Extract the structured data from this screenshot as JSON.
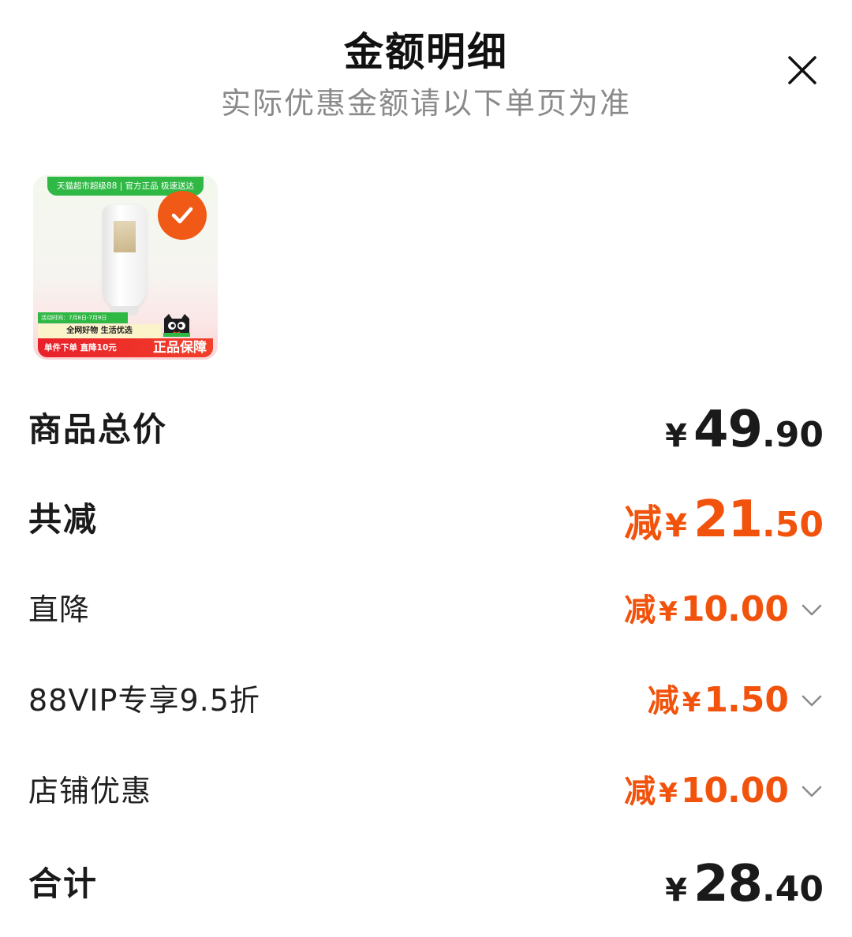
{
  "header": {
    "title": "金额明细",
    "subtitle": "实际优惠金额请以下单页为准",
    "close_icon": "close-icon"
  },
  "product": {
    "thumbnail": {
      "top_banner": "天猫超市超级88 | 官方正品 极速送达",
      "event_date": "活动时间：7月8日-7月9日",
      "slogan": "全网好物 生活优选",
      "promo": "单件下单 直降10元",
      "guarantee": "正品保障",
      "selected_icon": "check-circle-icon",
      "mascot_icon": "tmall-cat-icon"
    }
  },
  "summary": {
    "goods_total": {
      "label": "商品总价",
      "yen": "¥",
      "int": "49",
      "dec": ".90"
    },
    "total_discount": {
      "label": "共减",
      "prefix": "减",
      "yen": "¥",
      "int": "21",
      "dec": ".50"
    },
    "discounts": [
      {
        "label": "直降",
        "prefix": "减",
        "yen": "¥",
        "int": "10",
        "dec": ".00",
        "icon": "chevron-down-icon"
      },
      {
        "label": "88VIP专享9.5折",
        "prefix": "减",
        "yen": "¥",
        "int": "1",
        "dec": ".50",
        "icon": "chevron-down-icon"
      },
      {
        "label": "店铺优惠",
        "prefix": "减",
        "yen": "¥",
        "int": "10",
        "dec": ".00",
        "icon": "chevron-down-icon"
      }
    ],
    "grand_total": {
      "label": "合计",
      "yen": "¥",
      "int": "28",
      "dec": ".40"
    }
  },
  "colors": {
    "accent": "#f2530c",
    "text_primary": "#1a1a1a",
    "text_secondary": "#8a8a8a",
    "check_badge": "#f05a16",
    "tmall_green": "#2fb844",
    "promo_red": "#e8202a"
  }
}
